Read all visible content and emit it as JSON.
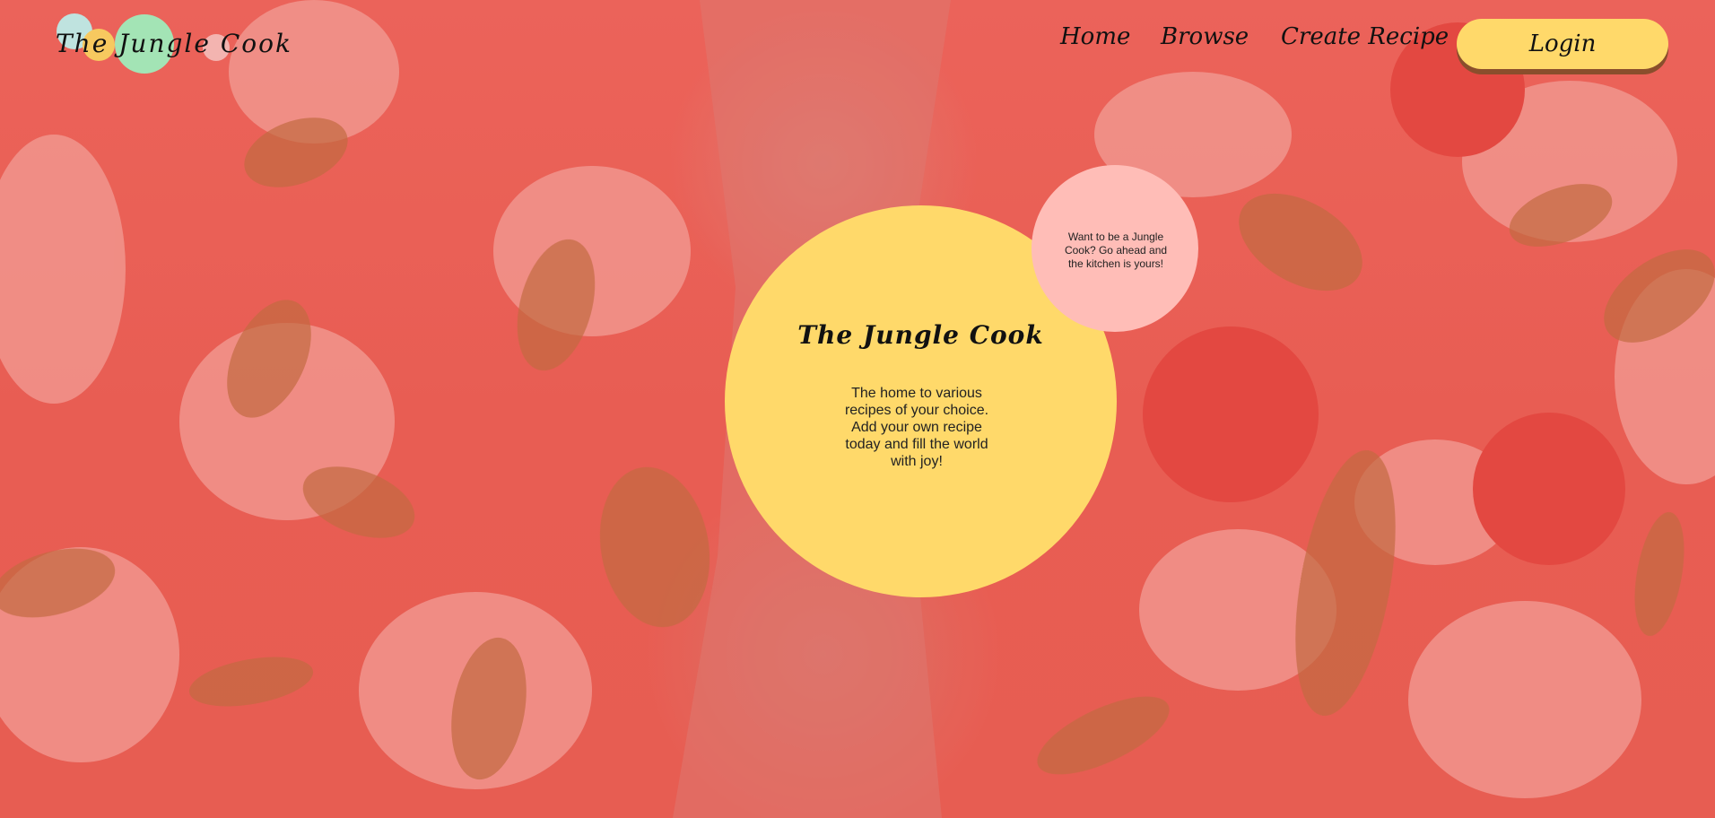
{
  "brand": {
    "name": "The Jungle Cook"
  },
  "nav": {
    "items": [
      {
        "label": "Home"
      },
      {
        "label": "Browse"
      },
      {
        "label": "Create Recipe"
      }
    ],
    "login_label": "Login"
  },
  "hero": {
    "title": "The Jungle Cook",
    "description": "The home to various recipes of your choice. Add your own recipe today and fill the world with joy!"
  },
  "promo": {
    "text": "Want to be a Jungle Cook? Go ahead and the kitchen is yours!"
  },
  "colors": {
    "background": "#e8554b",
    "hero_circle": "#ffd96a",
    "promo_circle": "#ffbdb7",
    "login_button": "#ffd96a",
    "logo_dots": [
      "#bfe3df",
      "#f7c95f",
      "#a3e4b5",
      "#f3b4b0"
    ]
  }
}
